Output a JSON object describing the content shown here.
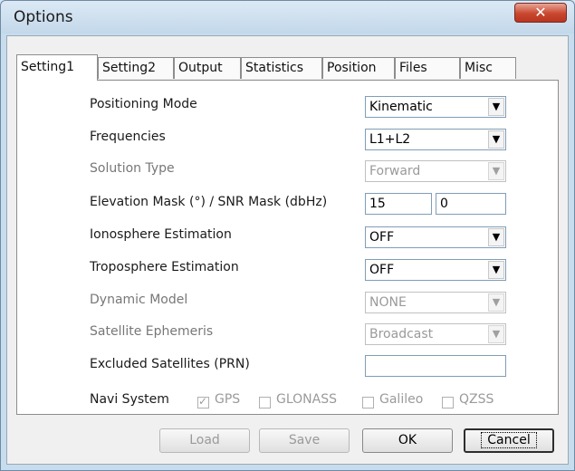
{
  "window": {
    "title": "Options",
    "close_glyph": "✕"
  },
  "tabs": [
    {
      "label": "Setting1",
      "active": true
    },
    {
      "label": "Setting2"
    },
    {
      "label": "Output"
    },
    {
      "label": "Statistics"
    },
    {
      "label": "Position"
    },
    {
      "label": "Files"
    },
    {
      "label": "Misc"
    }
  ],
  "settings": {
    "positioning_mode": {
      "label": "Positioning Mode",
      "value": "Kinematic"
    },
    "frequencies": {
      "label": "Frequencies",
      "value": "L1+L2"
    },
    "solution_type": {
      "label": "Solution Type",
      "value": "Forward",
      "enabled": false
    },
    "elevation_snr": {
      "label": "Elevation Mask (°) / SNR Mask (dbHz)",
      "elevation": "15",
      "snr": "0"
    },
    "ionosphere": {
      "label": "Ionosphere Estimation",
      "value": "OFF"
    },
    "troposphere": {
      "label": "Troposphere Estimation",
      "value": "OFF"
    },
    "dynamic_model": {
      "label": "Dynamic Model",
      "value": "NONE",
      "enabled": false
    },
    "ephemeris": {
      "label": "Satellite Ephemeris",
      "value": "Broadcast",
      "enabled": false
    },
    "excluded_sats": {
      "label": "Excluded Satellites (PRN)",
      "value": ""
    }
  },
  "navi": {
    "label": "Navi System",
    "systems": [
      {
        "label": "GPS",
        "checked": true
      },
      {
        "label": "GLONASS",
        "checked": false
      },
      {
        "label": "Galileo",
        "checked": false
      },
      {
        "label": "QZSS",
        "checked": false
      }
    ]
  },
  "buttons": {
    "load": "Load",
    "save": "Save",
    "ok": "OK",
    "cancel": "Cancel"
  },
  "icons": {
    "dropdown": "▼",
    "check": "✓"
  }
}
